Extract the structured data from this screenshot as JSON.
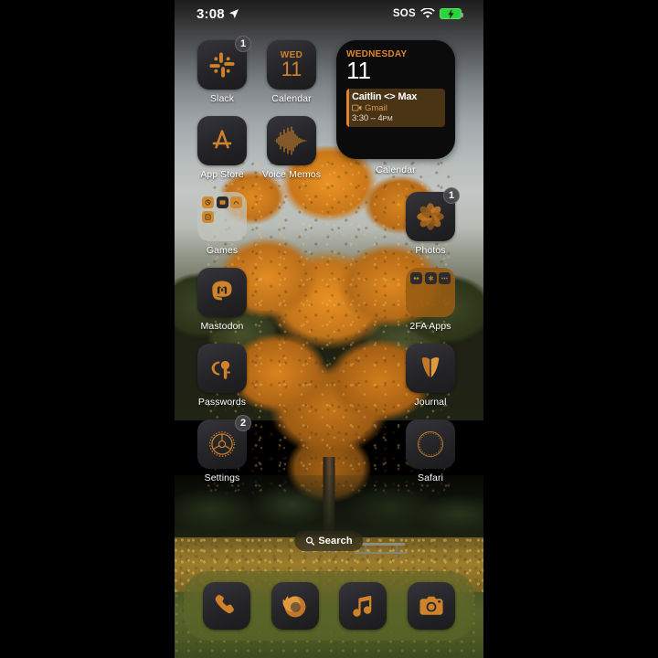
{
  "device": {
    "name": "iphone-home-screen"
  },
  "status_bar": {
    "time": "3:08",
    "location_icon": "location-arrow-icon",
    "sos_label": "SOS",
    "wifi_icon": "wifi-icon",
    "battery_icon": "battery-charging-icon",
    "battery_color": "#2bd43a"
  },
  "theme": {
    "tint_accent": "#d0822a",
    "icon_dark": "#262626",
    "label_color": "#ffffff"
  },
  "widget": {
    "name": "calendar-widget",
    "weekday": "WEDNESDAY",
    "date": "11",
    "app_label": "Calendar",
    "event": {
      "title": "Caitlin <> Max",
      "source_icon": "video-camera-icon",
      "source": "Gmail",
      "time": "3:30 – 4",
      "time_suffix": "PM"
    }
  },
  "apps": {
    "row1": [
      {
        "name": "slack",
        "label": "Slack",
        "icon": "slack-icon",
        "badge": "1"
      },
      {
        "name": "calendar",
        "label": "Calendar",
        "icon": "calendar-icon",
        "cal_day": "WED",
        "cal_date": "11"
      }
    ],
    "row2": [
      {
        "name": "app-store",
        "label": "App Store",
        "icon": "app-store-icon"
      },
      {
        "name": "voice-memos",
        "label": "Voice Memos",
        "icon": "waveform-icon"
      }
    ],
    "row3": [
      {
        "name": "games-folder",
        "label": "Games",
        "icon": "folder-icon"
      },
      {
        "name": "photos",
        "label": "Photos",
        "icon": "photos-icon",
        "badge": "1"
      }
    ],
    "row4": [
      {
        "name": "mastodon",
        "label": "Mastodon",
        "icon": "mastodon-icon"
      },
      {
        "name": "2fa-apps-folder",
        "label": "2FA Apps",
        "icon": "folder-icon"
      }
    ],
    "row5": [
      {
        "name": "passwords",
        "label": "Passwords",
        "icon": "key-icon"
      },
      {
        "name": "journal",
        "label": "Journal",
        "icon": "journal-icon"
      }
    ],
    "row6": [
      {
        "name": "settings",
        "label": "Settings",
        "icon": "gear-icon",
        "badge": "2"
      },
      {
        "name": "safari",
        "label": "Safari",
        "icon": "compass-icon"
      }
    ]
  },
  "search": {
    "label": "Search",
    "icon": "magnifier-icon"
  },
  "dock": [
    {
      "name": "phone",
      "icon": "phone-icon"
    },
    {
      "name": "firefox",
      "icon": "firefox-icon"
    },
    {
      "name": "music",
      "icon": "music-note-icon"
    },
    {
      "name": "camera",
      "icon": "camera-icon"
    }
  ]
}
